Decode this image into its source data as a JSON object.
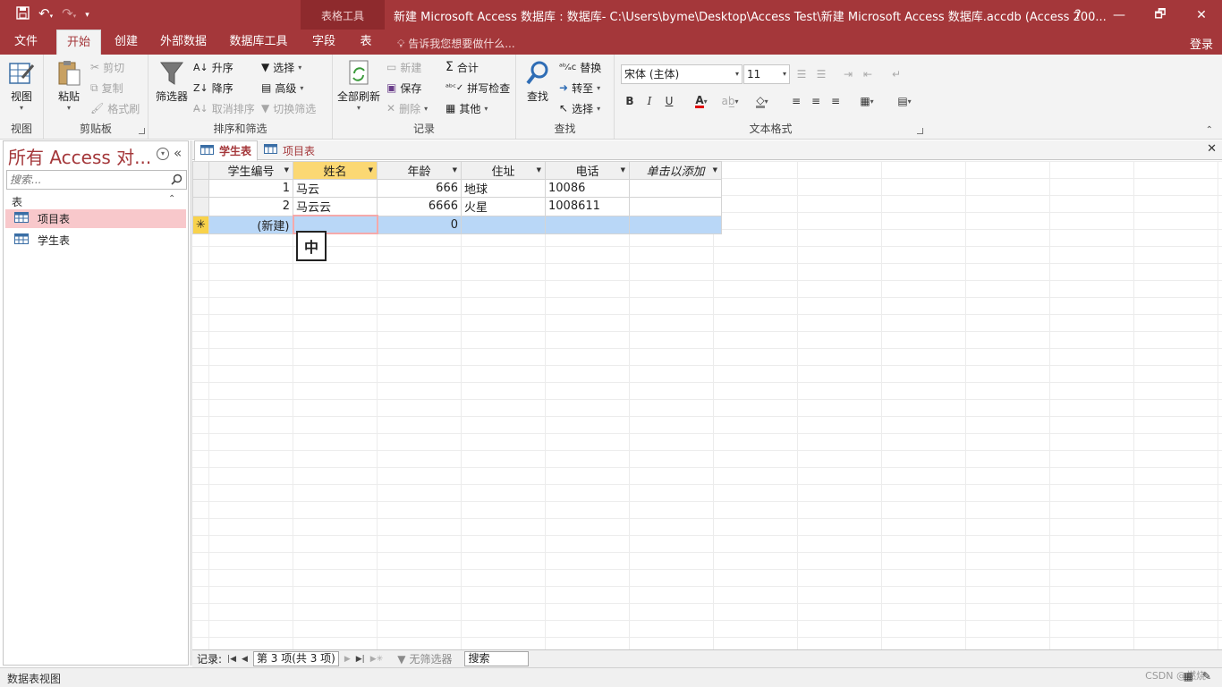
{
  "titlebar": {
    "context_label": "表格工具",
    "title": "新建 Microsoft Access 数据库 : 数据库- C:\\Users\\byme\\Desktop\\Access Test\\新建 Microsoft Access 数据库.accdb (Access 200...",
    "help": "?",
    "restore": "🗗",
    "minimize": "—",
    "close": "✕"
  },
  "tabs": {
    "file": "文件",
    "home": "开始",
    "create": "创建",
    "external": "外部数据",
    "dbtools": "数据库工具",
    "fields": "字段",
    "table": "表",
    "tellme": "告诉我您想要做什么...",
    "signin": "登录"
  },
  "ribbon": {
    "views": {
      "view": "视图",
      "label": "视图"
    },
    "clipboard": {
      "paste": "粘贴",
      "cut": "剪切",
      "copy": "复制",
      "format_painter": "格式刷",
      "label": "剪贴板"
    },
    "sort_filter": {
      "filter": "筛选器",
      "asc": "升序",
      "desc": "降序",
      "remove_sort": "取消排序",
      "selection": "选择",
      "advanced": "高级",
      "toggle_filter": "切换筛选",
      "label": "排序和筛选"
    },
    "records": {
      "refresh_all": "全部刷新",
      "new": "新建",
      "save": "保存",
      "delete": "删除",
      "totals": "合计",
      "spelling": "拼写检查",
      "more": "其他",
      "label": "记录"
    },
    "find": {
      "find": "查找",
      "replace": "替换",
      "goto": "转至",
      "select": "选择",
      "label": "查找"
    },
    "text_format": {
      "font": "宋体 (主体)",
      "size": "11",
      "bold": "B",
      "italic": "I",
      "underline": "U",
      "label": "文本格式"
    }
  },
  "nav": {
    "title": "所有 Access 对...",
    "search_placeholder": "搜索...",
    "section": "表",
    "items": [
      {
        "label": "项目表"
      },
      {
        "label": "学生表"
      }
    ]
  },
  "doc_tabs": [
    {
      "label": "学生表"
    },
    {
      "label": "项目表"
    }
  ],
  "datasheet": {
    "columns": [
      "学生编号",
      "姓名",
      "年龄",
      "住址",
      "电话",
      "单击以添加"
    ],
    "rows": [
      [
        "1",
        "马云",
        "666",
        "地球",
        "10086",
        ""
      ],
      [
        "2",
        "马云云",
        "6666",
        "火星",
        "1008611",
        ""
      ]
    ],
    "new_row": {
      "marker": "✳",
      "id": "(新建)",
      "name": "",
      "age": "0"
    },
    "ime": "中"
  },
  "record_nav": {
    "label": "记录:",
    "position": "第 3 项(共 3 项)",
    "filter": "无筛选器",
    "search": "搜索"
  },
  "status": {
    "text": "数据表视图",
    "watermark": "CSDN @燃烧"
  }
}
